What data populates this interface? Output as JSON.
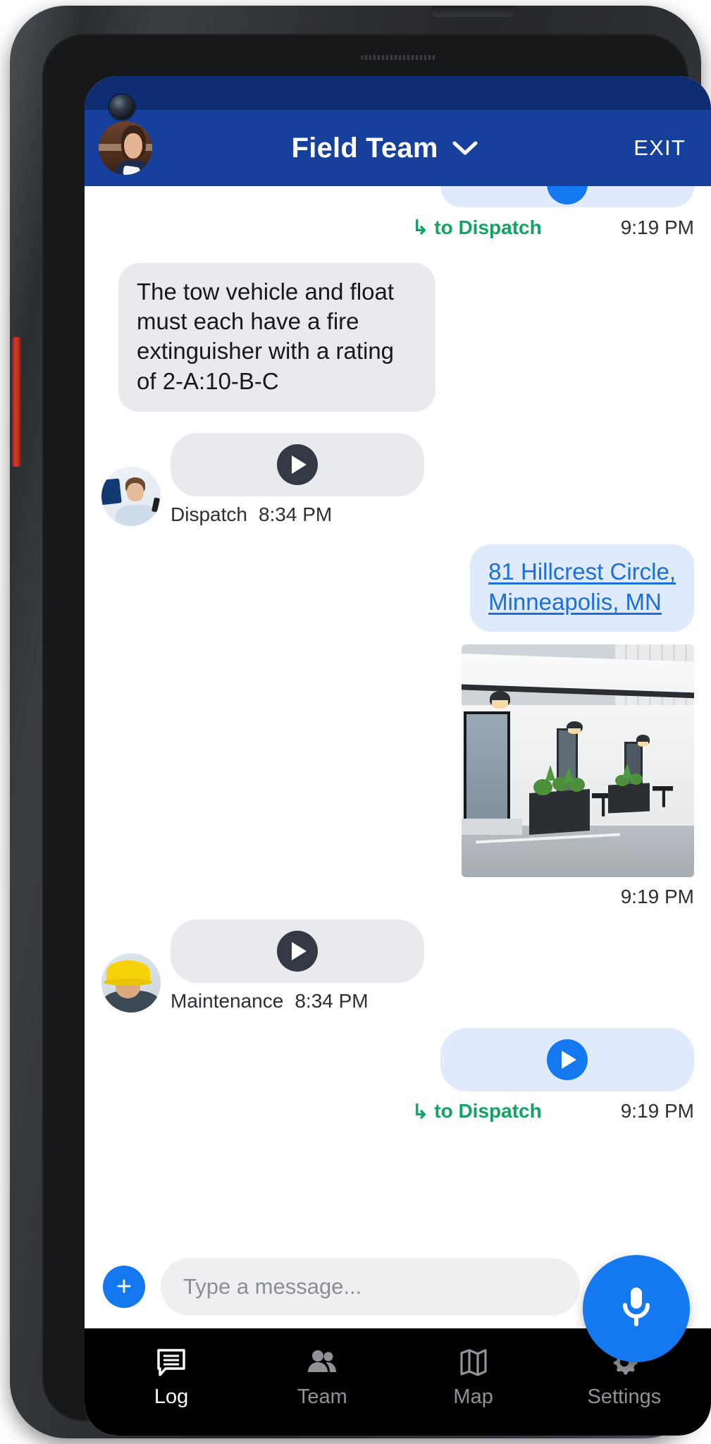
{
  "header": {
    "title": "Field Team",
    "exit_label": "EXIT",
    "dropdown_icon": "chevron-down-icon",
    "avatar_name": "user-avatar",
    "bg_color": "#17409c",
    "status_color": "#0f2d73"
  },
  "conversation": {
    "messages": [
      {
        "id": "m0",
        "type": "audio",
        "direction": "out",
        "partial": true,
        "forwarded_to": "to Dispatch",
        "forward_icon": "forward-arrow-icon",
        "time": "9:19 PM"
      },
      {
        "id": "m1",
        "type": "text",
        "direction": "in",
        "text": "The tow vehicle and float must each have a fire extinguisher with a rating of 2-A:10-B-C"
      },
      {
        "id": "m2",
        "type": "audio",
        "direction": "in",
        "sender": "Dispatch",
        "time": "8:34 PM",
        "avatar_name": "dispatch-avatar",
        "play_icon": "play-icon"
      },
      {
        "id": "m3",
        "type": "link",
        "direction": "out",
        "link_text": "81 Hillcrest Circle, Minneapolis, MN",
        "link_line_1": "81 Hillcrest Circle,",
        "link_line_2": "Minneapolis, MN",
        "link_color": "#1a6fdb"
      },
      {
        "id": "m4",
        "type": "photo",
        "direction": "out",
        "time": "9:19 PM",
        "alt": "Photo of white building facade with planters and outdoor lamps"
      },
      {
        "id": "m5",
        "type": "audio",
        "direction": "in",
        "sender": "Maintenance",
        "time": "8:34 PM",
        "avatar_name": "maintenance-avatar",
        "play_icon": "play-icon"
      },
      {
        "id": "m6",
        "type": "audio",
        "direction": "out",
        "forwarded_to": "to Dispatch",
        "forward_icon": "forward-arrow-icon",
        "time": "9:19 PM",
        "play_icon": "play-icon"
      }
    ],
    "forward_color": "#12a264",
    "bubble_in_color": "#e9eaee",
    "bubble_out_color": "#dfeafc"
  },
  "composer": {
    "add_label": "+",
    "add_icon": "plus-icon",
    "input_value": "",
    "input_placeholder": "Type a message...",
    "mic_icon": "microphone-icon",
    "accent_color": "#1478f0"
  },
  "bottom_nav": {
    "items": [
      {
        "label": "Log",
        "icon": "chat-log-icon",
        "active": true
      },
      {
        "label": "Team",
        "icon": "people-icon",
        "active": false
      },
      {
        "label": "Map",
        "icon": "map-icon",
        "active": false
      },
      {
        "label": "Settings",
        "icon": "gear-icon",
        "active": false
      }
    ],
    "active_color": "#ffffff",
    "inactive_color": "#8f9398",
    "bg_color": "#000000"
  }
}
